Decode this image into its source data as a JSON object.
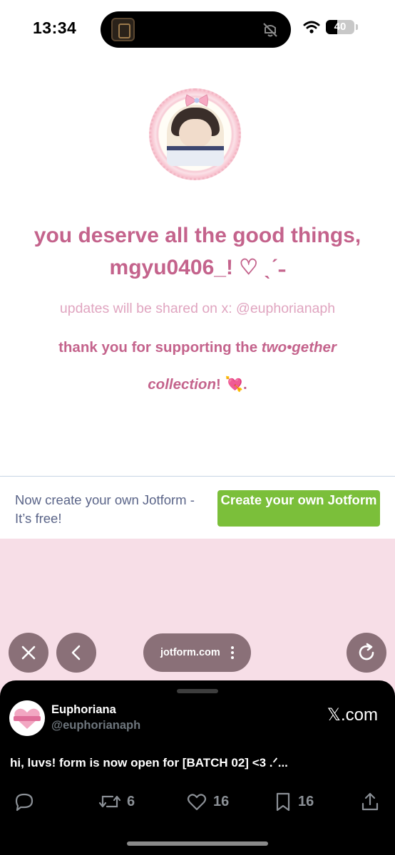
{
  "status_bar": {
    "time": "13:34",
    "battery": "40",
    "battery_level": 0.4
  },
  "form": {
    "headline": "you deserve all the good things, mgyu0406_! ♡ ˎˊ˗",
    "updates": "updates will be shared on x: @euphorianaph",
    "thanks_prefix": "thank you for supporting the ",
    "thanks_emph": "two•gether collection",
    "thanks_suffix": "! 💘."
  },
  "jotform_banner": {
    "text": "Now create your own Jotform - It’s free!",
    "button_label": "Create your own Jotform"
  },
  "browser": {
    "url": "jotform.com"
  },
  "tweet": {
    "name": "Euphoriana",
    "handle": "@euphorianaph",
    "brand": "𝕏.com",
    "text": "hi, luvs! form is now open for [BATCH 02] <3 .ᐟ...",
    "retweets": "6",
    "likes": "16",
    "bookmarks": "16"
  },
  "colors": {
    "headline_pink": "#c4638c",
    "light_pink": "#e0a5c0",
    "jotform_green": "#7bbf3a",
    "background_pink": "#f7dee7",
    "nav_button": "#8a7078"
  },
  "icons": [
    "island-album-icon",
    "mute-icon",
    "wifi-icon",
    "close-icon",
    "back-icon",
    "more-icon",
    "reload-icon",
    "reply-icon",
    "retweet-icon",
    "like-icon",
    "bookmark-icon",
    "share-icon"
  ]
}
